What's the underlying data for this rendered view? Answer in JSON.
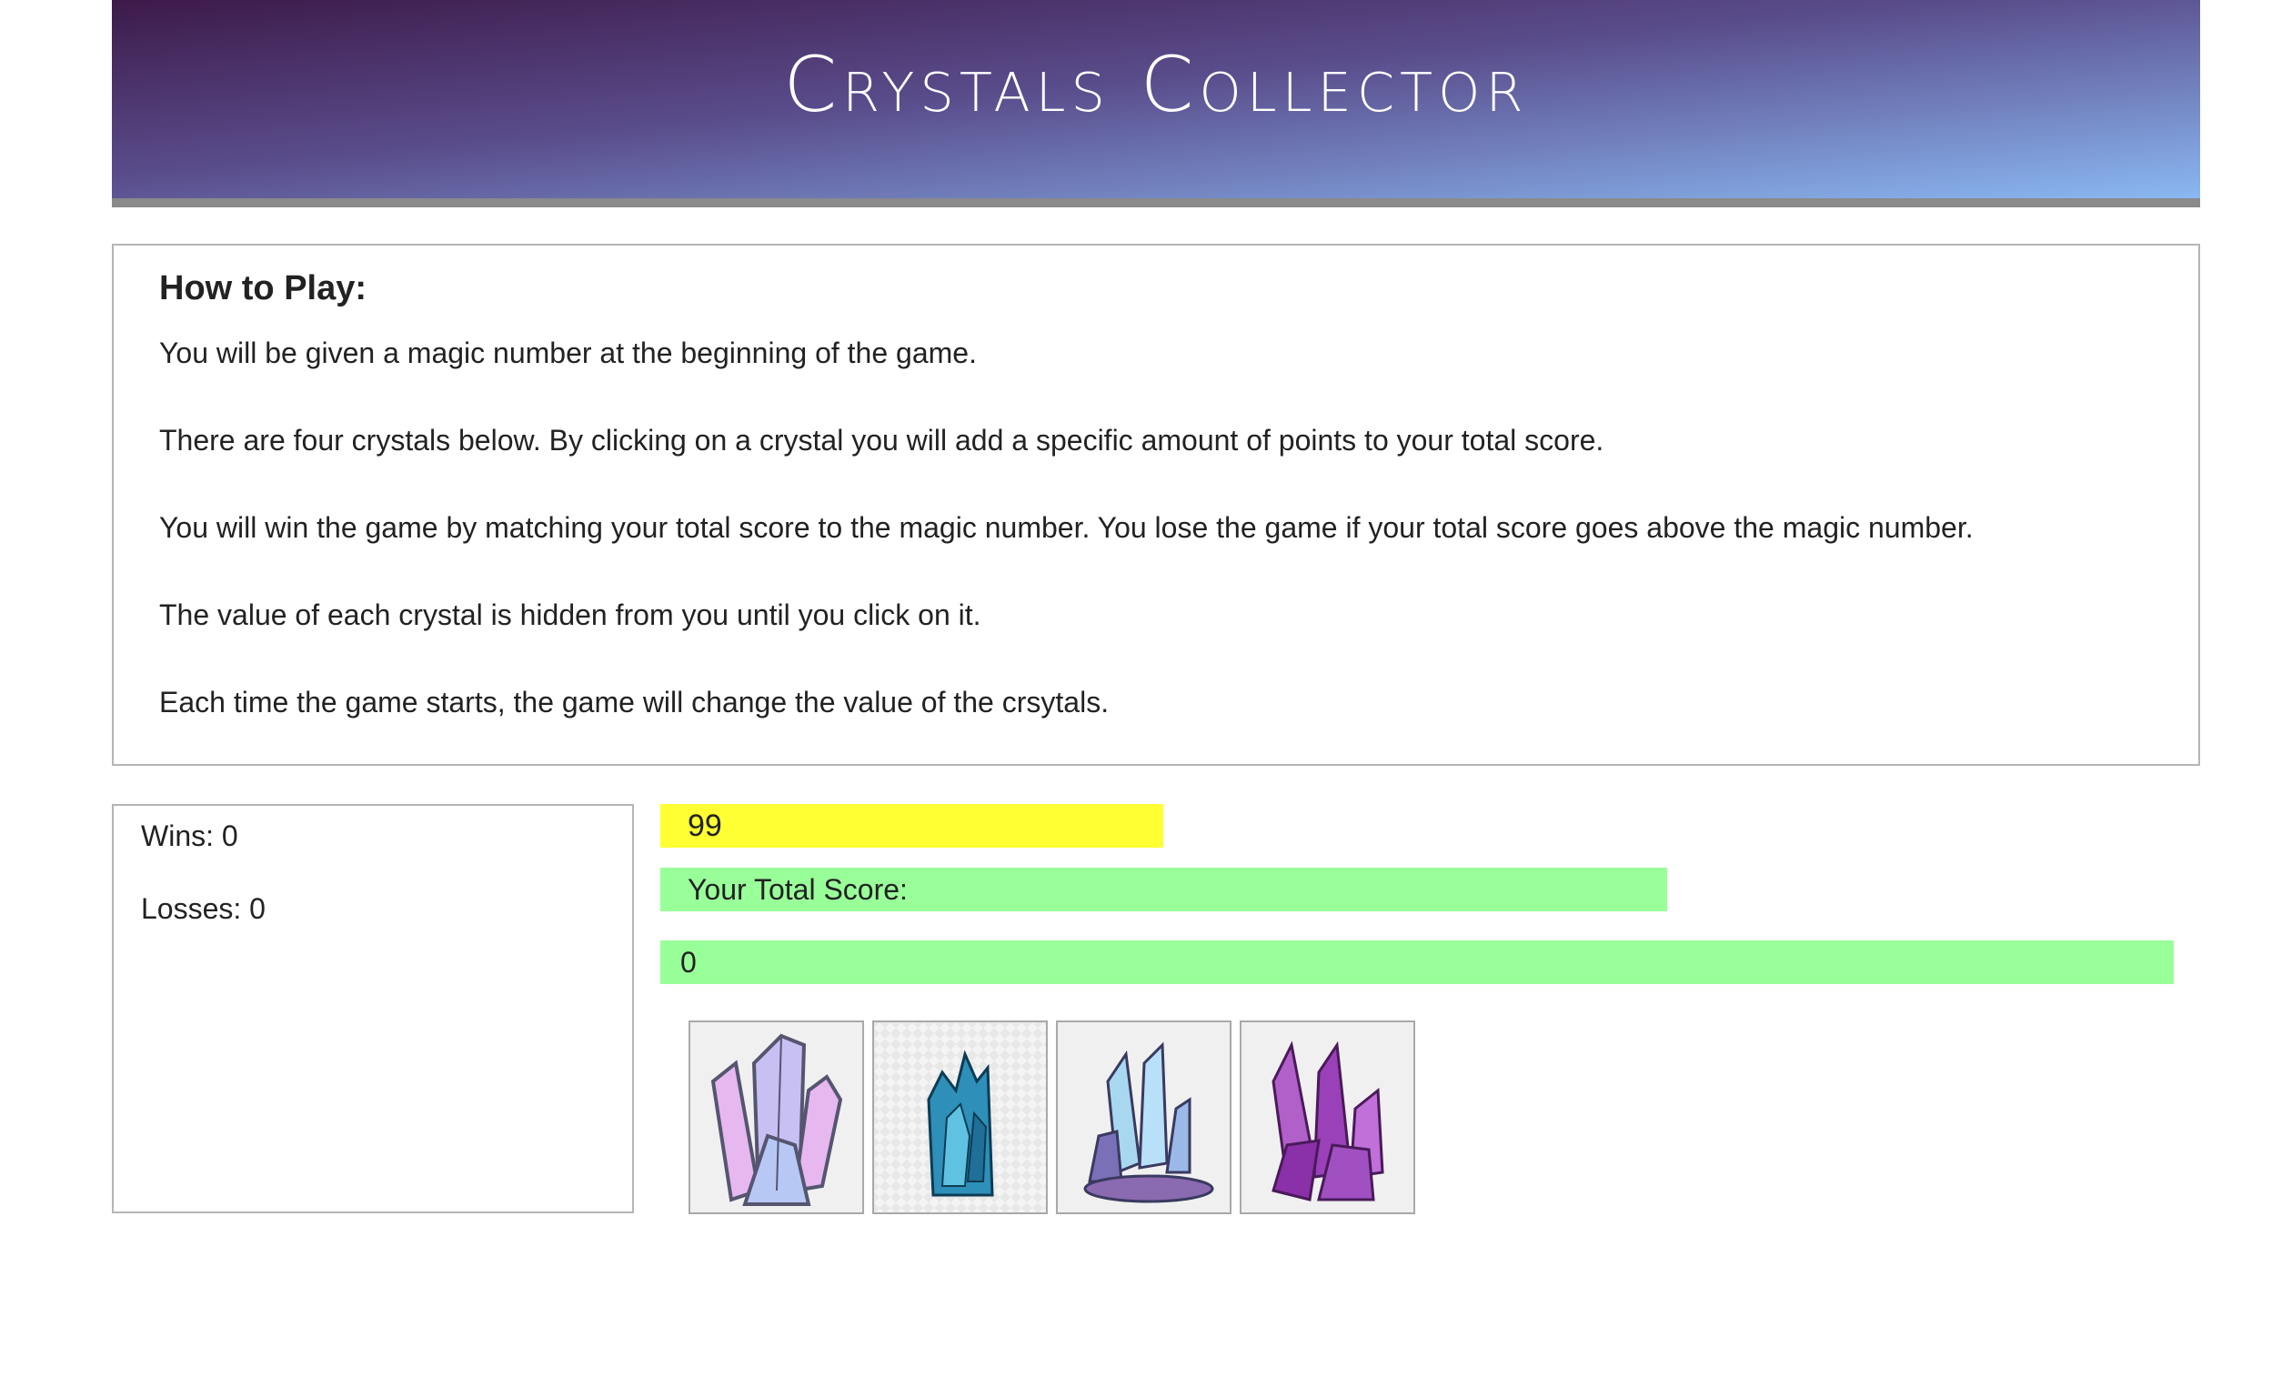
{
  "header": {
    "title": "Crystals Collector"
  },
  "instructions": {
    "heading": "How to Play:",
    "lines": [
      "You will be given a magic number at the beginning of the game.",
      "There are four crystals below. By clicking on a crystal you will add a specific amount of points to your total score.",
      "You will win the game by matching your total score to the magic number. You lose the game if your total score goes above the magic number.",
      "The value of each crystal is hidden from you until you click on it.",
      "Each time the game starts, the game will change the value of the crsytals."
    ]
  },
  "stats": {
    "wins": "Wins: 0",
    "losses": "Losses: 0"
  },
  "magic_number": "99",
  "score": {
    "label": "Your Total Score:",
    "value": "0"
  },
  "colors": {
    "magic_bg": "#ffff33",
    "score_bg": "#99ff99"
  },
  "crystals": [
    {
      "icon": "pink-blue-crystal-icon"
    },
    {
      "icon": "teal-crystal-icon"
    },
    {
      "icon": "blue-purple-crystal-cluster-icon"
    },
    {
      "icon": "purple-amethyst-crystal-icon"
    }
  ]
}
